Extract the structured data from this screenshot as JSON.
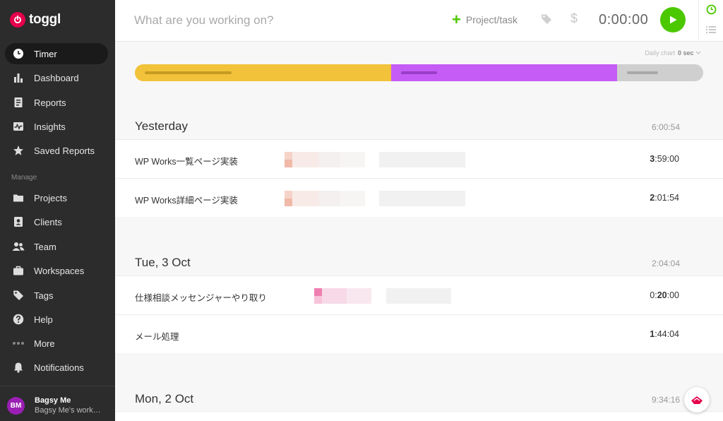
{
  "brand": {
    "name": "toggl",
    "color": "#e5004c"
  },
  "sidebar": {
    "items": [
      {
        "label": "Timer",
        "icon": "clock-icon",
        "active": true
      },
      {
        "label": "Dashboard",
        "icon": "bar-chart-icon"
      },
      {
        "label": "Reports",
        "icon": "report-icon"
      },
      {
        "label": "Insights",
        "icon": "pulse-icon"
      },
      {
        "label": "Saved Reports",
        "icon": "star-icon"
      }
    ],
    "manage_label": "Manage",
    "manage_items": [
      {
        "label": "Projects",
        "icon": "folder-icon"
      },
      {
        "label": "Clients",
        "icon": "contact-icon"
      },
      {
        "label": "Team",
        "icon": "team-icon"
      },
      {
        "label": "Workspaces",
        "icon": "briefcase-icon"
      },
      {
        "label": "Tags",
        "icon": "tag-icon"
      },
      {
        "label": "Help",
        "icon": "help-icon"
      },
      {
        "label": "More",
        "icon": "more-icon"
      },
      {
        "label": "Notifications",
        "icon": "bell-icon"
      }
    ],
    "user": {
      "initials": "BM",
      "name": "Bagsy Me",
      "workspace": "Bagsy Me's workspace"
    }
  },
  "timer": {
    "placeholder": "What are you working on?",
    "project_label": "Project/task",
    "time": "0:00:00",
    "accent": "#4bc800"
  },
  "daily_chart": {
    "label": "Daily chart",
    "value": "0 sec"
  },
  "progress_bar": {
    "segments": [
      {
        "color": "#f2c23a",
        "line": "#c79a22",
        "fraction": 0.451
      },
      {
        "color": "#c55cf5",
        "line": "#9a3dc8",
        "fraction": 0.397
      },
      {
        "color": "#cfcfcf",
        "line": "#a8a8a8",
        "fraction": 0.152
      }
    ]
  },
  "days": [
    {
      "title": "Yesterday",
      "total": "6:00:54",
      "entries": [
        {
          "description": "WP Works一覧ページ実装",
          "duration_prefix": "3",
          "duration_rest": ":59:00"
        },
        {
          "description": "WP Works詳細ページ実装",
          "duration_prefix": "2",
          "duration_rest": ":01:54"
        }
      ]
    },
    {
      "title": "Tue, 3 Oct",
      "total": "2:04:04",
      "entries": [
        {
          "description": "仕様相談メッセンジャーやり取り",
          "duration_prefix": "0:",
          "duration_bold": "20",
          "duration_rest": ":00"
        },
        {
          "description": "メール処理",
          "duration_prefix": "1",
          "duration_rest": ":44:04"
        }
      ]
    },
    {
      "title": "Mon, 2 Oct",
      "total": "9:34:16"
    }
  ]
}
